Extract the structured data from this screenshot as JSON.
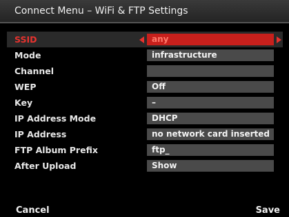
{
  "title": "Connect Menu – WiFi & FTP Settings",
  "settings": [
    {
      "label": "SSID",
      "value": "any"
    },
    {
      "label": "Mode",
      "value": "infrastructure"
    },
    {
      "label": "Channel",
      "value": ""
    },
    {
      "label": "WEP",
      "value": "Off"
    },
    {
      "label": "Key",
      "value": "–"
    },
    {
      "label": "IP Address Mode",
      "value": "DHCP"
    },
    {
      "label": "IP Address",
      "value": "no network card inserted"
    },
    {
      "label": "FTP Album Prefix",
      "value": "ftp_"
    },
    {
      "label": "After Upload",
      "value": "Show"
    }
  ],
  "footer": {
    "cancel_label": "Cancel",
    "save_label": "Save"
  },
  "colors": {
    "accent": "#c7201c",
    "highlight_text": "#e8322e",
    "field_bg": "#4a4a4a"
  }
}
